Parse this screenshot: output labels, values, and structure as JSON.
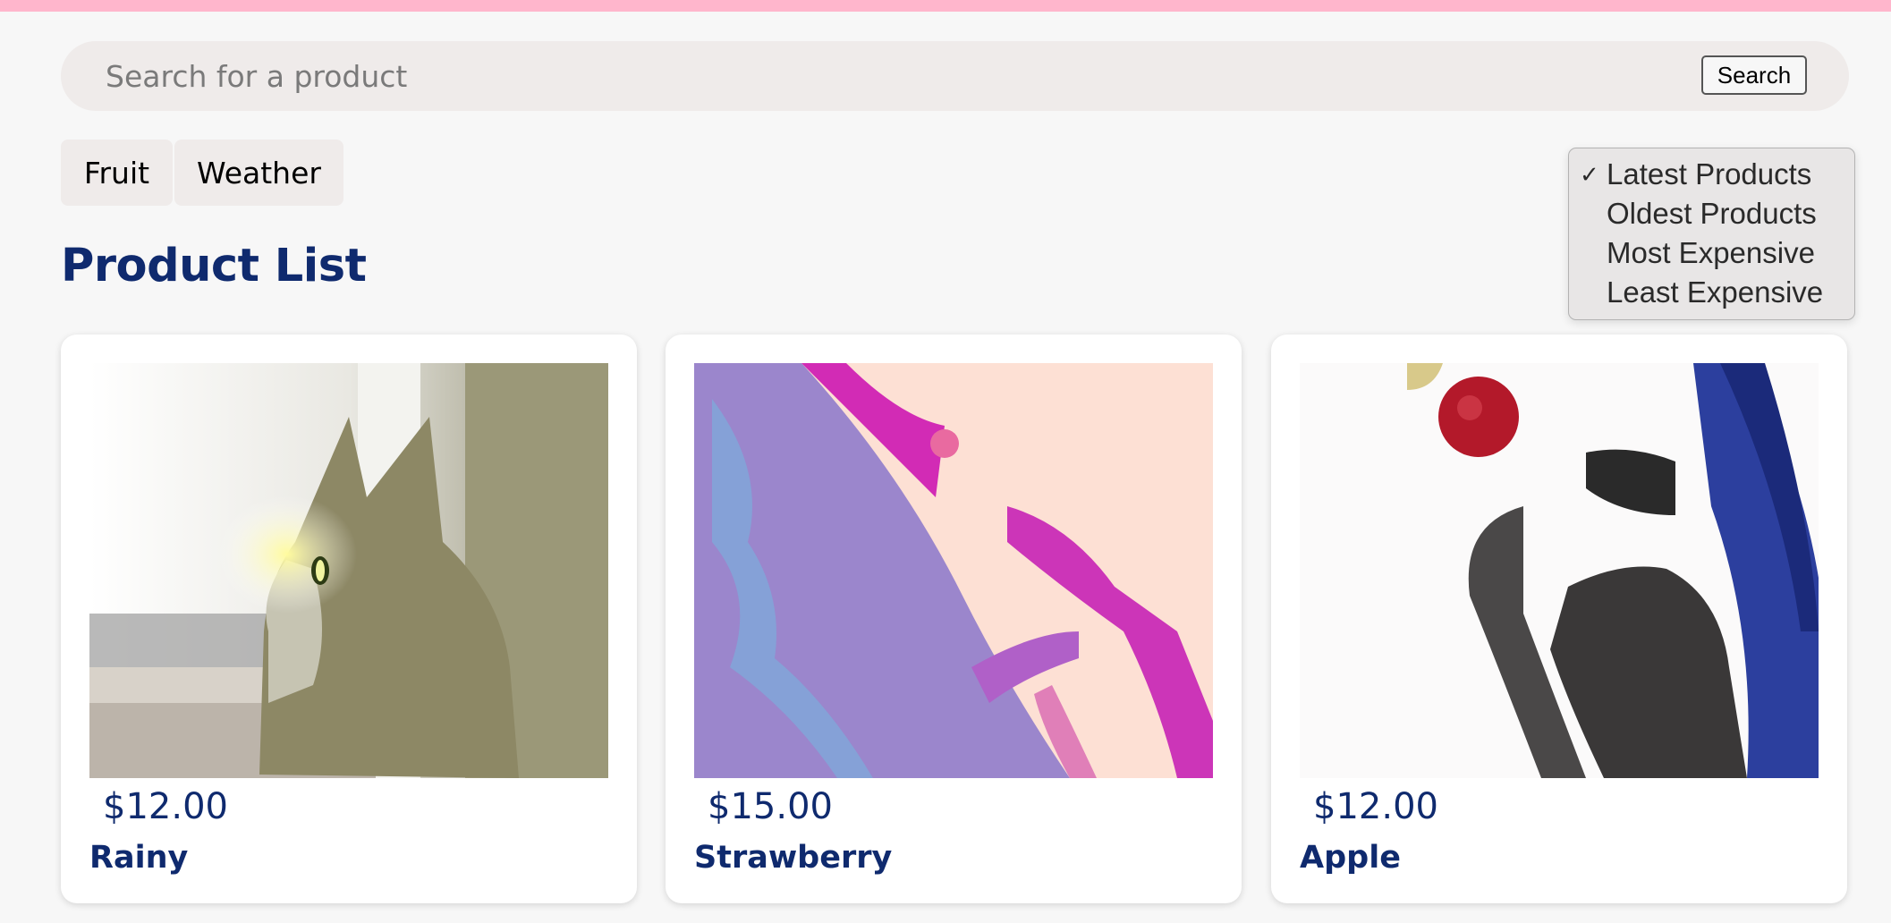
{
  "search": {
    "placeholder": "Search for a product",
    "button_label": "Search"
  },
  "categories": [
    {
      "label": "Fruit"
    },
    {
      "label": "Weather"
    }
  ],
  "page_title": "Product List",
  "sort": {
    "check_glyph": "✓",
    "selected": "Latest Products",
    "options": [
      {
        "label": "Latest Products"
      },
      {
        "label": "Oldest Products"
      },
      {
        "label": "Most Expensive"
      },
      {
        "label": "Least Expensive"
      }
    ]
  },
  "products": [
    {
      "name": "Rainy",
      "price": "$12.00",
      "image_icon": "cat-at-window-artwork"
    },
    {
      "name": "Strawberry",
      "price": "$15.00",
      "image_icon": "pink-purple-abstract-artwork"
    },
    {
      "name": "Apple",
      "price": "$12.00",
      "image_icon": "woman-with-red-apple-artwork"
    }
  ],
  "colors": {
    "accent_bar": "#ffb6cc",
    "brand_text": "#0f2a6e",
    "chip_background": "#efebea",
    "page_background": "#f7f7f7"
  }
}
